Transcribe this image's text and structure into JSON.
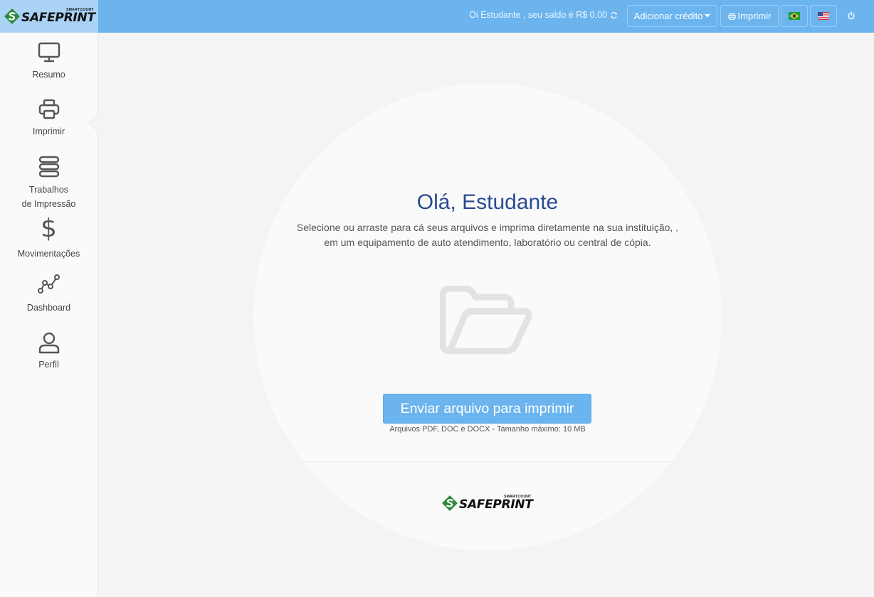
{
  "brand": {
    "small": "SMARTCOUNT",
    "name": "SAFEPRINT"
  },
  "header": {
    "greeting": "Oi Estudante , seu saldo é R$ 0,00",
    "add_credit_label": "Adicionar crédito",
    "print_label": "Imprimir",
    "languages": [
      "pt-BR-flag-icon",
      "en-US-flag-icon"
    ]
  },
  "sidebar": {
    "items": [
      {
        "label": "Resumo",
        "icon": "monitor-icon"
      },
      {
        "label": "Imprimir",
        "icon": "printer-icon",
        "active": true
      },
      {
        "label_line1": "Trabalhos",
        "label_line2": "de Impressão",
        "icon": "stack-icon"
      },
      {
        "label": "Movimentações",
        "icon": "dollar-icon"
      },
      {
        "label": "Dashboard",
        "icon": "line-chart-icon"
      },
      {
        "label": "Perfil",
        "icon": "user-icon"
      }
    ]
  },
  "main": {
    "title": "Olá, Estudante",
    "description": "Selecione ou arraste para cá seus arquivos e imprima diretamente na sua instituição, , em um equipamento de auto atendimento, laboratório ou central de cópia.",
    "upload_button": "Enviar arquivo para imprimir",
    "upload_hint": "Arquivos PDF, DOC e DOCX - Tamanho máximo: 10 MB"
  },
  "colors": {
    "topbar": "#6bb4ee",
    "logo_bg": "#a9d2f4",
    "title": "#2a4a92",
    "button": "#6bb4ee",
    "brand_green": "#2f8a3e"
  }
}
